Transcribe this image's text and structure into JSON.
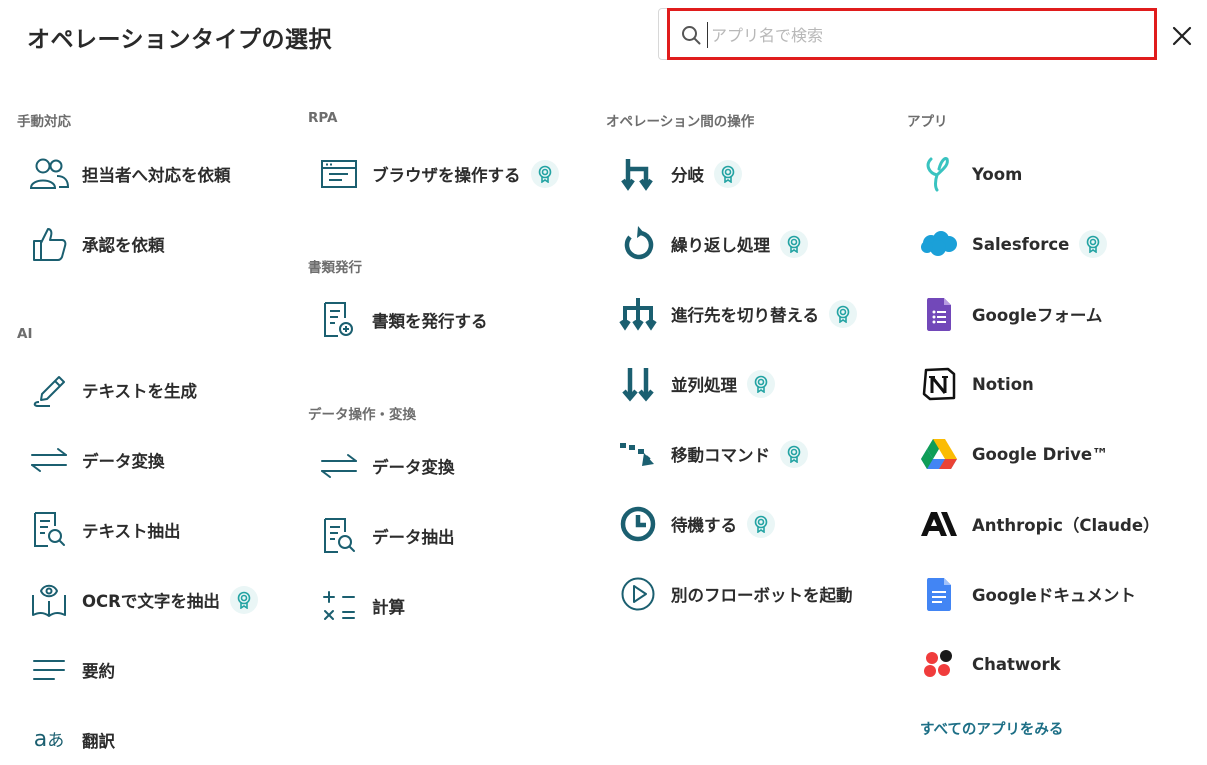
{
  "header": {
    "title": "オペレーションタイプの選択",
    "search_placeholder": "アプリ名で検索"
  },
  "colors": {
    "accent": "#1d6f86",
    "icon_teal": "#1b5f70",
    "highlight_red": "#e01c1c",
    "badge_bg": "#eaf6f6"
  },
  "columns": {
    "manual": {
      "label": "手動対応",
      "items": [
        {
          "label": "担当者へ対応を依頼",
          "icon": "people-icon",
          "badge": false
        },
        {
          "label": "承認を依頼",
          "icon": "thumbs-up-icon",
          "badge": false
        }
      ]
    },
    "ai": {
      "label": "AI",
      "items": [
        {
          "label": "テキストを生成",
          "icon": "pen-icon",
          "badge": false
        },
        {
          "label": "データ変換",
          "icon": "arrows-exchange-icon",
          "badge": false
        },
        {
          "label": "テキスト抽出",
          "icon": "document-search-icon",
          "badge": false
        },
        {
          "label": "OCRで文字を抽出",
          "icon": "book-eye-icon",
          "badge": true
        },
        {
          "label": "要約",
          "icon": "lines-icon",
          "badge": false
        },
        {
          "label": "翻訳",
          "icon": "translate-icon",
          "badge": false
        }
      ]
    },
    "rpa": {
      "label": "RPA",
      "items": [
        {
          "label": "ブラウザを操作する",
          "icon": "browser-icon",
          "badge": true
        }
      ]
    },
    "docs": {
      "label": "書類発行",
      "items": [
        {
          "label": "書類を発行する",
          "icon": "document-add-icon",
          "badge": false
        }
      ]
    },
    "data_ops": {
      "label": "データ操作・変換",
      "items": [
        {
          "label": "データ変換",
          "icon": "arrows-exchange-icon",
          "badge": false
        },
        {
          "label": "データ抽出",
          "icon": "document-search-icon",
          "badge": false
        },
        {
          "label": "計算",
          "icon": "calculator-symbols-icon",
          "badge": false
        }
      ]
    },
    "flow_ops": {
      "label": "オペレーション間の操作",
      "items": [
        {
          "label": "分岐",
          "icon": "branch-icon",
          "badge": true
        },
        {
          "label": "繰り返し処理",
          "icon": "loop-icon",
          "badge": true
        },
        {
          "label": "進行先を切り替える",
          "icon": "switch-route-icon",
          "badge": true
        },
        {
          "label": "並列処理",
          "icon": "parallel-icon",
          "badge": true
        },
        {
          "label": "移動コマンド",
          "icon": "move-icon",
          "badge": true
        },
        {
          "label": "待機する",
          "icon": "clock-icon",
          "badge": true
        },
        {
          "label": "別のフローボットを起動",
          "icon": "play-circle-icon",
          "badge": false
        }
      ]
    },
    "apps": {
      "label": "アプリ",
      "items": [
        {
          "label": "Yoom",
          "icon": "yoom-logo-icon",
          "badge": false
        },
        {
          "label": "Salesforce",
          "icon": "salesforce-logo-icon",
          "badge": true
        },
        {
          "label": "Googleフォーム",
          "icon": "google-forms-logo-icon",
          "badge": false
        },
        {
          "label": "Notion",
          "icon": "notion-logo-icon",
          "badge": false
        },
        {
          "label": "Google Drive™",
          "icon": "google-drive-logo-icon",
          "badge": false
        },
        {
          "label": "Anthropic（Claude）",
          "icon": "anthropic-logo-icon",
          "badge": false
        },
        {
          "label": "Googleドキュメント",
          "icon": "google-docs-logo-icon",
          "badge": false
        },
        {
          "label": "Chatwork",
          "icon": "chatwork-logo-icon",
          "badge": false
        }
      ],
      "view_all": "すべてのアプリをみる"
    }
  }
}
